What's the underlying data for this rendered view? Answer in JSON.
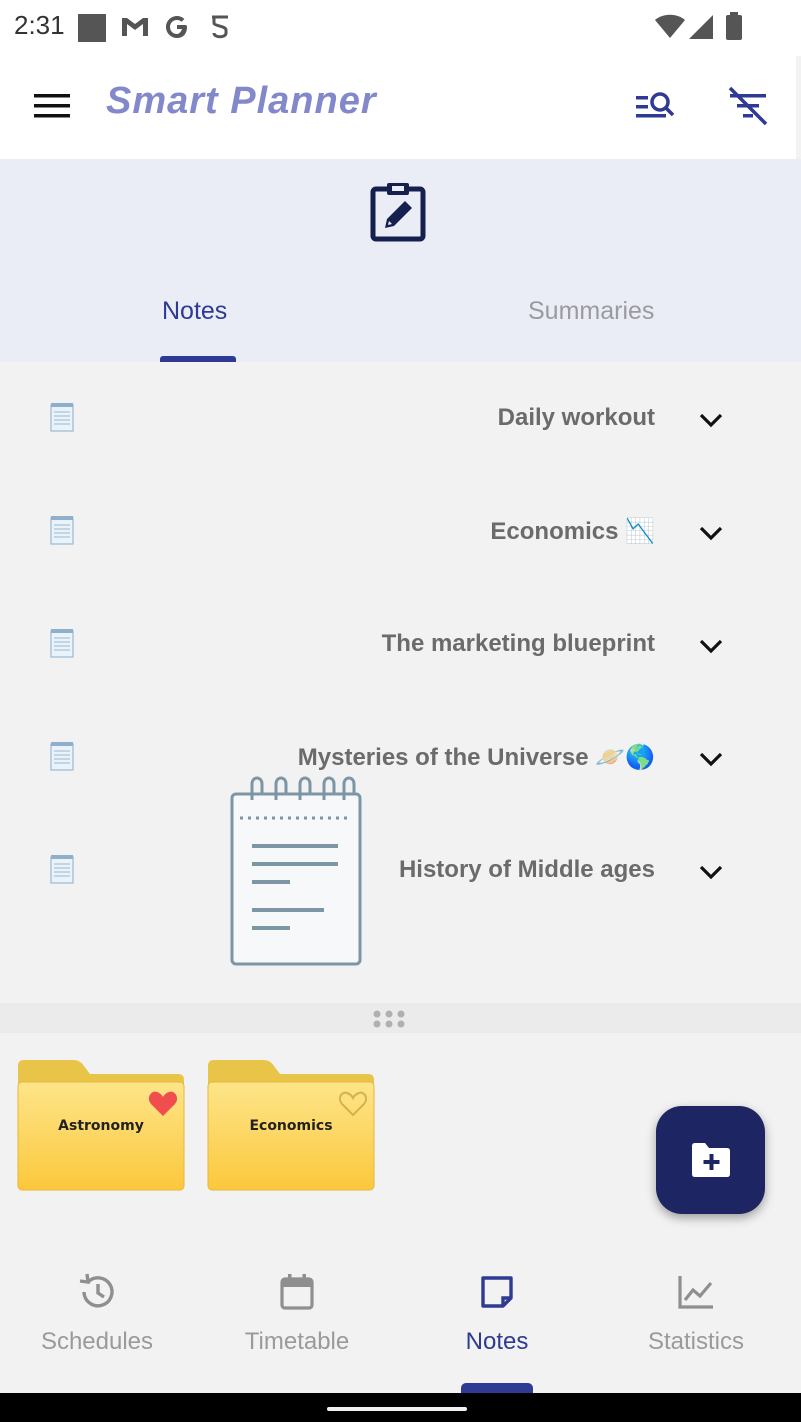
{
  "status_bar": {
    "time": "2:31",
    "icons": [
      "square-icon",
      "gmail-icon",
      "google-icon",
      "s-app-icon",
      "dot-icon",
      "wifi-icon",
      "signal-icon",
      "battery-icon"
    ]
  },
  "app_bar": {
    "title": "Smart Planner",
    "icons": [
      "menu-icon",
      "search-list-icon",
      "filter-off-icon"
    ]
  },
  "header": {
    "icon": "edit-clipboard-icon",
    "tabs": [
      {
        "label": "Notes",
        "active": true
      },
      {
        "label": "Summaries",
        "active": false
      }
    ]
  },
  "notes": [
    {
      "title": "Daily workout",
      "icon": "notepad-icon"
    },
    {
      "title": "Economics 📉",
      "icon": "notepad-icon"
    },
    {
      "title": "The marketing blueprint",
      "icon": "notepad-icon"
    },
    {
      "title": "Mysteries of the Universe 🪐🌎",
      "icon": "notepad-icon"
    },
    {
      "title": "History of Middle ages",
      "icon": "notepad-icon"
    }
  ],
  "folders": [
    {
      "label": "Astronomy",
      "favorite": true
    },
    {
      "label": "Economics",
      "favorite": false
    }
  ],
  "fab": {
    "icon": "add-folder-icon"
  },
  "bottom_nav": [
    {
      "label": "Schedules",
      "icon": "history-icon",
      "active": false
    },
    {
      "label": "Timetable",
      "icon": "calendar-icon",
      "active": false
    },
    {
      "label": "Notes",
      "icon": "sticky-note-icon",
      "active": true
    },
    {
      "label": "Statistics",
      "icon": "chart-icon",
      "active": false
    }
  ],
  "colors": {
    "accent": "#2e3a94",
    "title": "#8288c9",
    "fab": "#1d2562",
    "header_bg": "#eaedf6",
    "heart_filled": "#f04e4e",
    "folder": "#fcd15a"
  }
}
